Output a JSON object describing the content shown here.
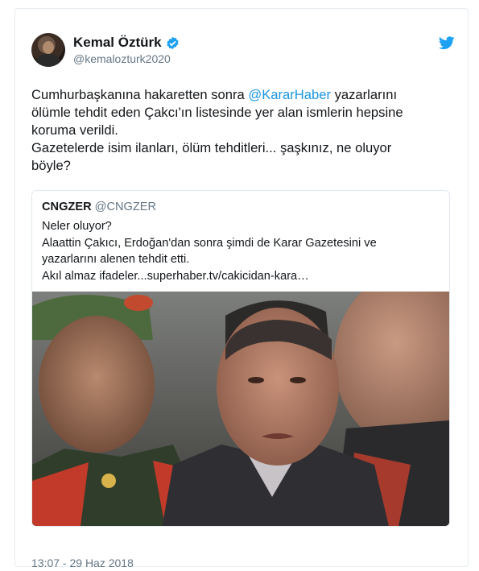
{
  "tweet": {
    "author": {
      "display_name": "Kemal Öztürk",
      "handle": "@kemalozturk2020"
    },
    "text": {
      "line1_before_mention": "Cumhurbaşkanına hakaretten sonra ",
      "mention": "@KararHaber",
      "line1_after_mention": " yazarlarını",
      "rest": "ölümle tehdit eden Çakcı'ın listesinde yer alan ismlerin hepsine\nkoruma verildi.\nGazetelerde isim ilanları, ölüm tehditleri... şaşkınız, ne oluyor\nböyle?"
    },
    "timestamp": "13:07 - 29 Haz 2018"
  },
  "quoted_tweet": {
    "display_name": "CNGZER",
    "handle": "@CNGZER",
    "text": "Neler oluyor?\nAlaattin Çakıcı, Erdoğan'dan sonra şimdi de Karar Gazetesini ve\nyazarlarını alenen tehdit etti.\nAkıl almaz ifadeler...superhaber.tv/cakicidan-kara…"
  },
  "colors": {
    "accent": "#1da1f2",
    "link": "#1b95e0",
    "secondary_text": "#657786"
  },
  "icons": {
    "brand": "twitter-bird-icon",
    "verified": "verified-badge-icon"
  }
}
